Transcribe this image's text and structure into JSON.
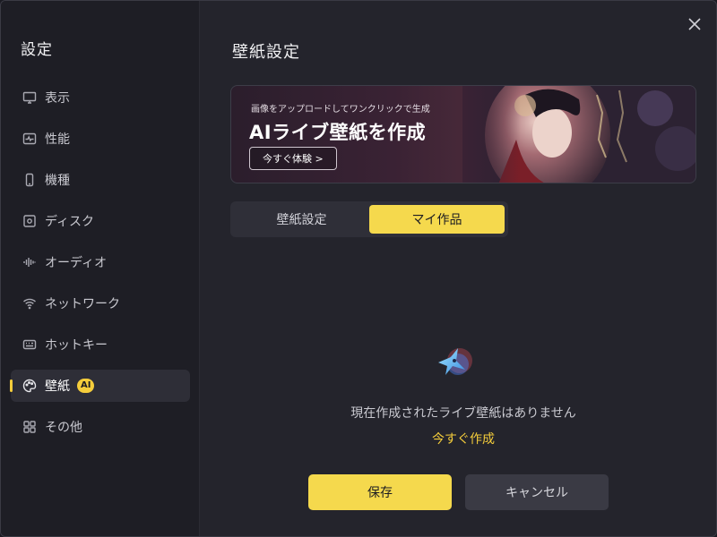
{
  "sidebar": {
    "title": "設定",
    "items": [
      {
        "label": "表示",
        "icon": "monitor-icon"
      },
      {
        "label": "性能",
        "icon": "pulse-icon"
      },
      {
        "label": "機種",
        "icon": "phone-icon"
      },
      {
        "label": "ディスク",
        "icon": "disk-icon"
      },
      {
        "label": "オーディオ",
        "icon": "audio-wave-icon"
      },
      {
        "label": "ネットワーク",
        "icon": "wifi-icon"
      },
      {
        "label": "ホットキー",
        "icon": "keyboard-icon"
      },
      {
        "label": "壁紙",
        "icon": "palette-icon",
        "badge": "AI",
        "active": true
      },
      {
        "label": "その他",
        "icon": "grid-icon"
      }
    ]
  },
  "main": {
    "title": "壁紙設定",
    "banner": {
      "subtitle": "画像をアップロードしてワンクリックで生成",
      "title": "AIライブ壁紙を作成",
      "button": "今すぐ体験 >"
    },
    "tabs": [
      {
        "label": "壁紙設定",
        "active": false
      },
      {
        "label": "マイ作品",
        "active": true
      }
    ],
    "empty_message": "現在作成されたライブ壁紙はありません",
    "create_link": "今すぐ作成"
  },
  "footer": {
    "save_label": "保存",
    "cancel_label": "キャンセル"
  },
  "colors": {
    "accent": "#f5d94d",
    "background": "#24242c",
    "sidebar": "#1e1e25"
  }
}
